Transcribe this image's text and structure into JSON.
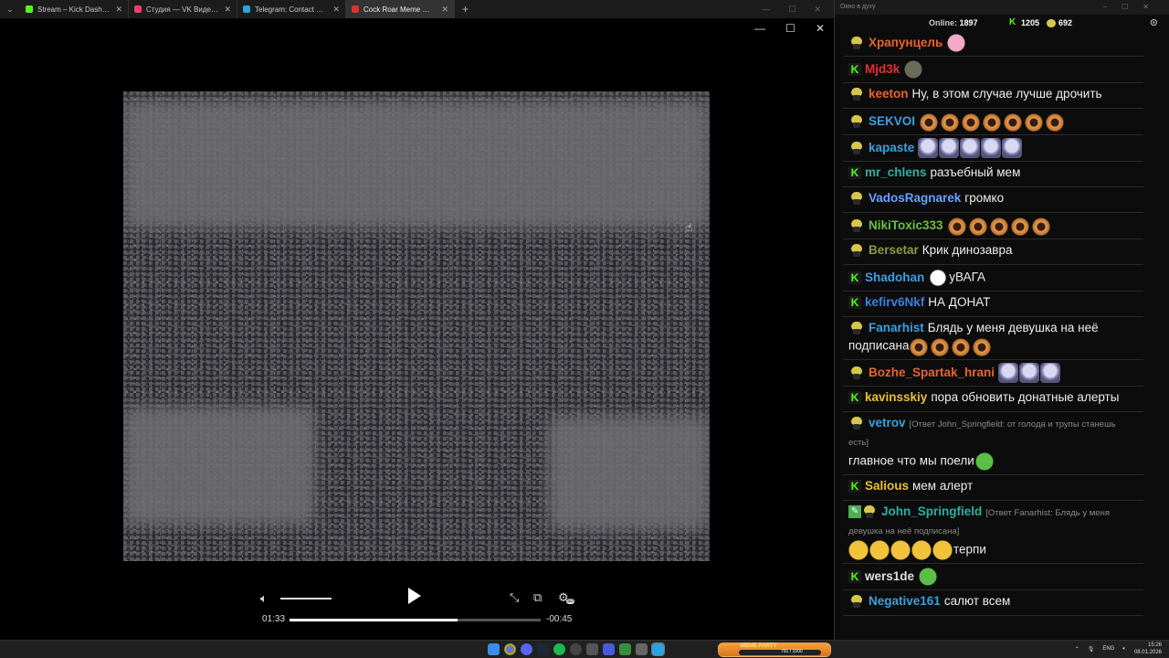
{
  "browser": {
    "tabs": [
      {
        "title": "Stream – Kick Dashboard",
        "color": "#53fc18"
      },
      {
        "title": "Студия — VK Видео Live",
        "color": "#e64070"
      },
      {
        "title": "Telegram: Contact @boris_rozh",
        "color": "#2aa3e0"
      },
      {
        "title": "Cock Roar Meme 🐓💀 (Roost",
        "color": "#e03030"
      }
    ],
    "new_tab": "+"
  },
  "player": {
    "time_current": "01:33",
    "time_remaining": "-00:45",
    "progress": 0.67,
    "volume": 0.9,
    "quality_badge": "SD"
  },
  "chat": {
    "window_title": "Окно в духу",
    "online_label": "Online:",
    "online_count": "1897",
    "kick_count": "1205",
    "vk_count": "692",
    "messages": [
      {
        "badge": "s",
        "user": "Храпунцель",
        "color": "#e8642c",
        "text": "",
        "emotes": [
          "pink"
        ]
      },
      {
        "badge": "k",
        "user": "Mjd3k",
        "color": "#e53030",
        "text": "",
        "emotes": [
          "dark"
        ]
      },
      {
        "badge": "s",
        "user": "keeton",
        "color": "#e8642c",
        "text": "Ну, в этом случае лучше дрочить",
        "emotes": []
      },
      {
        "badge": "s",
        "user": "SEKVOI",
        "color": "#3aa0e0",
        "text": "",
        "emotes": [
          "scream",
          "scream",
          "scream",
          "scream",
          "scream",
          "scream",
          "scream"
        ]
      },
      {
        "badge": "s",
        "user": "kapaste",
        "color": "#3aa0e0",
        "text": "",
        "emotes": [
          "ghost",
          "ghost",
          "ghost",
          "ghost",
          "ghost"
        ]
      },
      {
        "badge": "k",
        "user": "mr_chlens",
        "color": "#2ab0a0",
        "text": "разъебный мем",
        "emotes": []
      },
      {
        "badge": "s",
        "user": "VadosRagnarek",
        "color": "#6aa0ff",
        "text": "громко",
        "emotes": []
      },
      {
        "badge": "s",
        "user": "NikiToxic333",
        "color": "#6ac040",
        "text": "",
        "emotes": [
          "scream",
          "scream",
          "scream",
          "scream",
          "scream"
        ]
      },
      {
        "badge": "s",
        "user": "Bersetar",
        "color": "#8a9a40",
        "text": "Крик динозавра",
        "emotes": []
      },
      {
        "badge": "k",
        "user": "Shadohan",
        "color": "#3aa0e0",
        "text": "уВАГА",
        "emotes": [
          "white"
        ]
      },
      {
        "badge": "k",
        "user": "kefirv6Nkf",
        "color": "#3a80e0",
        "text": "НА ДОНАТ",
        "emotes": []
      },
      {
        "badge": "s",
        "user": "Fanarhist",
        "color": "#3aa0e0",
        "text": "Блядь у меня девушка на неё подписана",
        "emotes": [
          "scream",
          "scream",
          "scream",
          "scream"
        ]
      },
      {
        "badge": "s",
        "user": "Bozhe_Spartak_hrani",
        "color": "#e8642c",
        "text": "",
        "emotes": [
          "ghost",
          "ghost",
          "ghost"
        ]
      },
      {
        "badge": "k",
        "user": "kavinsskiy",
        "color": "#e8c030",
        "text": "пора обновить донатные алерты",
        "emotes": []
      },
      {
        "badge": "s",
        "user": "vetrov",
        "color": "#3aa0e0",
        "reply": "[Ответ John_Springfield: от голода и трупы станешь есть]",
        "text": "главное что мы поели",
        "emotes": [
          "pepe"
        ]
      },
      {
        "badge": "k",
        "user": "Salious",
        "color": "#e8c030",
        "text": "мем алерт",
        "emotes": []
      },
      {
        "badge": "ms",
        "user": "John_Springfield",
        "color": "#2ab0a0",
        "reply": "[Ответ Fanarhist: Блядь у меня девушка на неё подписана]",
        "text": "терпи",
        "emotes": [
          "lol",
          "lol",
          "lol",
          "lol",
          "lol"
        ]
      },
      {
        "badge": "k",
        "user": "wers1de",
        "color": "#e0e0e0",
        "text": "",
        "emotes": [
          "pepe"
        ]
      },
      {
        "badge": "s",
        "user": "Negative161",
        "color": "#3aa0e0",
        "text": "салют всем",
        "emotes": []
      }
    ]
  },
  "taskbar": {
    "widget_title": "MEME PARTY",
    "widget_value": "791 / 1500",
    "lang": "ENG",
    "time": "15:26",
    "date": "08.01.2026"
  }
}
